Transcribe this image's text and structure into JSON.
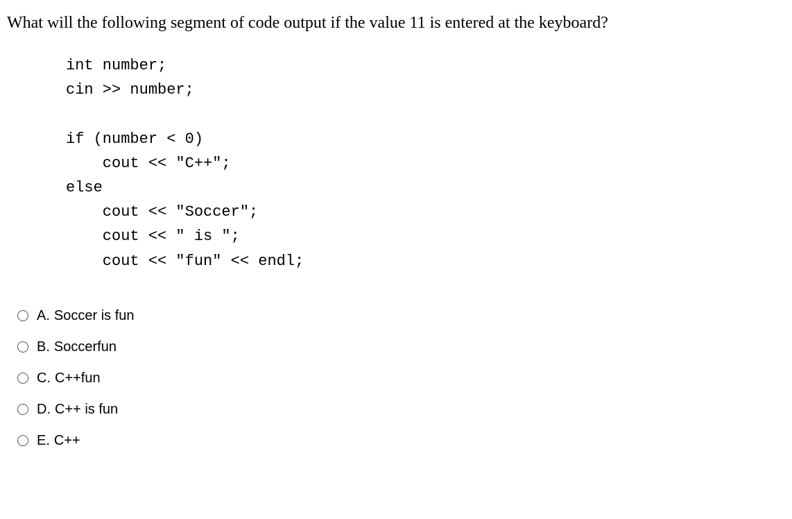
{
  "question": "What will the following segment of code output if the value 11 is entered at the keyboard?",
  "code": {
    "line1": "int number;",
    "line2": "cin >> number;",
    "line3": "",
    "line4": "if (number < 0)",
    "line5": "    cout << \"C++\";",
    "line6": "else",
    "line7": "    cout << \"Soccer\";",
    "line8": "    cout << \" is \";",
    "line9": "    cout << \"fun\" << endl;"
  },
  "options": [
    {
      "letter": "A.",
      "text": " Soccer is fun"
    },
    {
      "letter": "B.",
      "text": "Soccerfun"
    },
    {
      "letter": "C.",
      "text": "C++fun"
    },
    {
      "letter": "D.",
      "text": "C++ is fun"
    },
    {
      "letter": "E.",
      "text": "C++"
    }
  ]
}
